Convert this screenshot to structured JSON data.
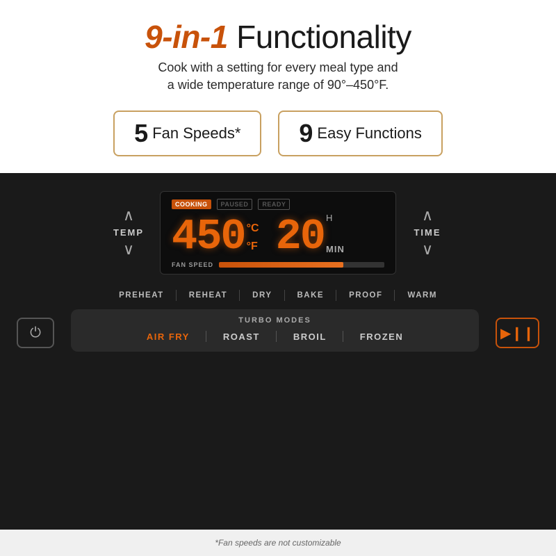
{
  "header": {
    "title_highlight": "9-in-1",
    "title_regular": " Functionality",
    "subtitle_line1": "Cook with a setting for every meal type and",
    "subtitle_line2": "a wide temperature range of 90°–450°F."
  },
  "badges": [
    {
      "number": "5",
      "text": "Fan Speeds*"
    },
    {
      "number": "9",
      "text": "Easy Functions"
    }
  ],
  "display": {
    "status_cooking": "COOKING",
    "status_paused": "PAUSED",
    "status_ready": "READY",
    "temp_value": "450",
    "temp_unit": "°F",
    "temp_c": "°C",
    "time_value": "20",
    "time_unit": "MIN",
    "time_h": "H",
    "fan_speed_label": "FAN SPEED",
    "fan_bar_percent": 75
  },
  "controls": {
    "temp_label": "TEMP",
    "time_label": "TIME",
    "arrow_up": "∧",
    "arrow_down": "∨"
  },
  "function_buttons": [
    "PREHEAT",
    "REHEAT",
    "DRY",
    "BAKE",
    "PROOF",
    "WARM"
  ],
  "turbo": {
    "label": "TURBO MODES",
    "buttons": [
      {
        "label": "AIR FRY",
        "active": true
      },
      {
        "label": "ROAST",
        "active": false
      },
      {
        "label": "BROIL",
        "active": false
      },
      {
        "label": "FROZEN",
        "active": false
      }
    ]
  },
  "power_icon": "⏻",
  "play_pause_icon": "▶ ❙❙",
  "footnote": "*Fan speeds are not customizable"
}
